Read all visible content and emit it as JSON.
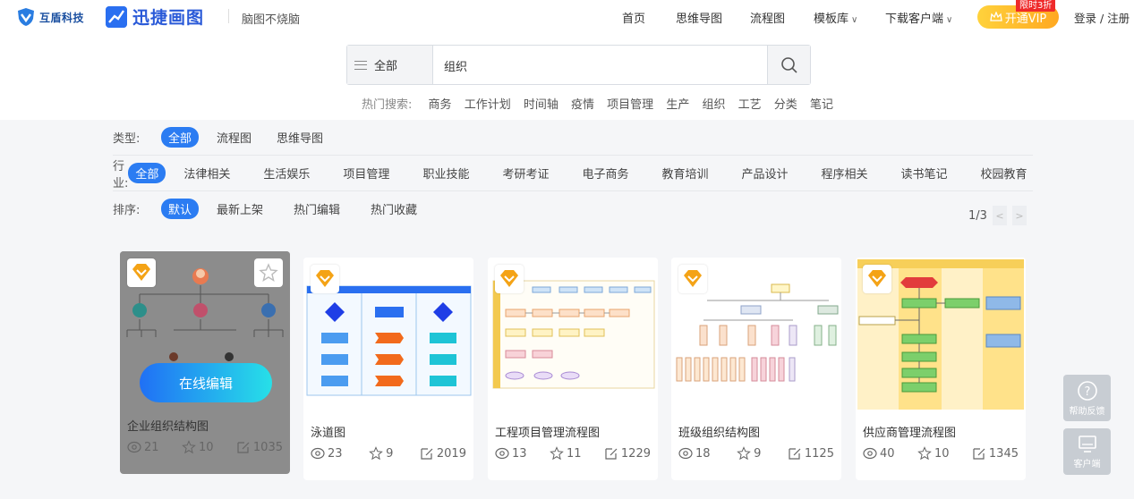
{
  "header": {
    "brand1": "互盾科技",
    "brand2": "迅捷画图",
    "slogan": "脑图不烧脑",
    "nav": [
      {
        "label": "首页"
      },
      {
        "label": "思维导图"
      },
      {
        "label": "流程图"
      },
      {
        "label": "模板库"
      },
      {
        "label": "下载客户端"
      }
    ],
    "vip_label": "开通VIP",
    "vip_badge": "限时3折",
    "login": "登录 / 注册"
  },
  "search": {
    "scope": "全部",
    "value": "组织",
    "hot_label": "热门搜索:",
    "hot_keywords": [
      "商务",
      "工作计划",
      "时间轴",
      "疫情",
      "项目管理",
      "生产",
      "组织",
      "工艺",
      "分类",
      "笔记"
    ]
  },
  "filters": {
    "type": {
      "label": "类型:",
      "options": [
        "全部",
        "流程图",
        "思维导图"
      ]
    },
    "industry": {
      "label": "行业:",
      "options": [
        "全部",
        "法律相关",
        "生活娱乐",
        "项目管理",
        "职业技能",
        "考研考证",
        "电子商务",
        "教育培训",
        "产品设计",
        "程序相关",
        "读书笔记",
        "校园教育"
      ]
    },
    "sort": {
      "label": "排序:",
      "options": [
        "默认",
        "最新上架",
        "热门编辑",
        "热门收藏"
      ]
    }
  },
  "pager": {
    "text": "1/3"
  },
  "cards": [
    {
      "title": "企业组织结构图",
      "views": "21",
      "stars": "10",
      "edits": "1035",
      "action": "在线编辑"
    },
    {
      "title": "泳道图",
      "views": "23",
      "stars": "9",
      "edits": "2019"
    },
    {
      "title": "工程项目管理流程图",
      "views": "13",
      "stars": "11",
      "edits": "1229"
    },
    {
      "title": "班级组织结构图",
      "views": "18",
      "stars": "9",
      "edits": "1125"
    },
    {
      "title": "供应商管理流程图",
      "views": "40",
      "stars": "10",
      "edits": "1345"
    }
  ],
  "side": {
    "feedback": "帮助反馈",
    "client": "客户端"
  },
  "colors": {
    "accent": "#2b7cf2",
    "vip": "#ffb020",
    "badge": "#f4a316"
  }
}
